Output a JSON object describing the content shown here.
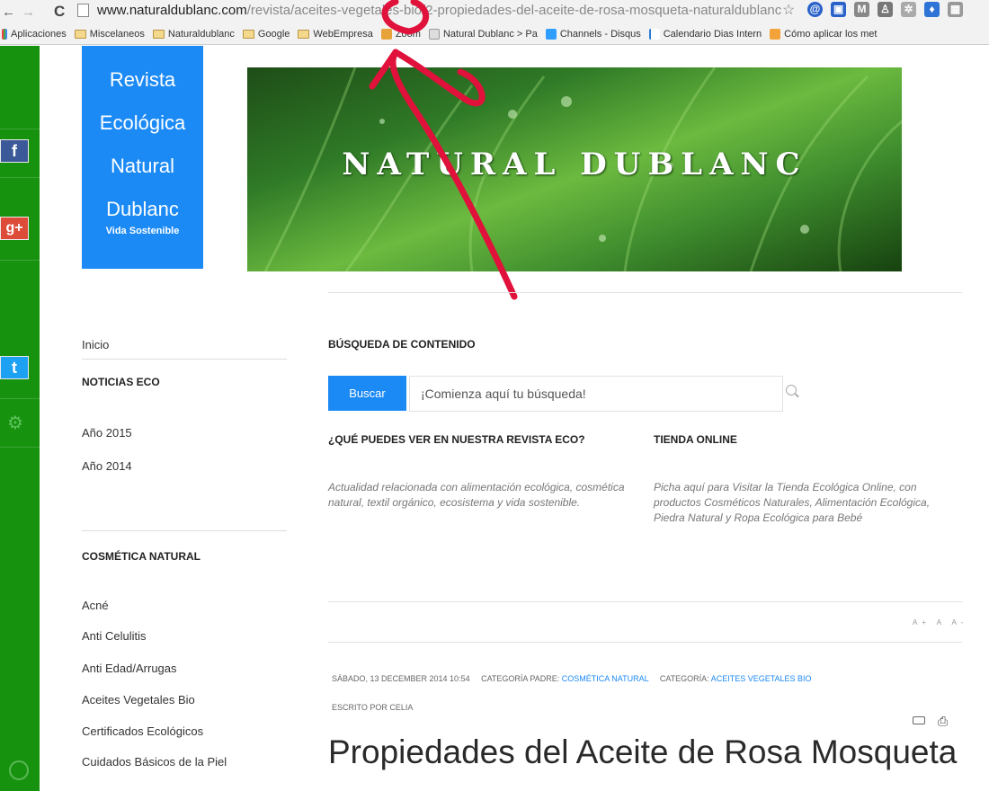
{
  "browser": {
    "url_host": "www.naturaldublanc.com",
    "url_path": "/revista/aceites-vegetales-bio/2-propiedades-del-aceite-de-rosa-mosqueta-naturaldublanc",
    "bookmarks": [
      "Aplicaciones",
      "Miscelaneos",
      "Naturaldublanc",
      "Google",
      "WebEmpresa",
      "Zoom",
      "Natural Dublanc > Pa",
      "Channels - Disqus",
      "Calendario Dias Intern",
      "Cómo aplicar los met"
    ]
  },
  "social": {
    "facebook": "f",
    "googleplus": "g+",
    "twitter": "t"
  },
  "logo": {
    "line1": "Revista",
    "line2": "Ecológica",
    "line3": "Natural",
    "line4": "Dublanc",
    "tagline": "Vida Sostenible"
  },
  "banner": {
    "title": "NATURAL DUBLANC"
  },
  "menu": {
    "home": "Inicio",
    "noticias_heading": "NOTICIAS ECO",
    "years": [
      "Año 2015",
      "Año 2014"
    ],
    "cosmetica_heading": "COSMÉTICA NATURAL",
    "cosmetica_items": [
      "Acné",
      "Anti Celulitis",
      "Anti Edad/Arrugas",
      "Aceites Vegetales Bio",
      "Certificados Ecológicos",
      "Cuidados Básicos de la Piel"
    ]
  },
  "search": {
    "title": "BÚSQUEDA DE CONTENIDO",
    "button": "Buscar",
    "placeholder": "¡Comienza aquí tu búsqueda!"
  },
  "columns": {
    "que_title": "¿QUÉ PUEDES VER EN NUESTRA REVISTA ECO?",
    "que_text": "Actualidad relacionada con alimentación ecológica, cosmética natural, textil orgánico, ecosistema y vida sostenible.",
    "tienda_title": "TIENDA ONLINE",
    "tienda_text": "Picha aquí para Visitar la Tienda Ecológica Online, con productos Cosméticos Naturales, Alimentación Ecológica, Piedra Natural y Ropa Ecológica para Bebé"
  },
  "font_tools": "A+ A A-",
  "article": {
    "date": "SÁBADO, 13 DECEMBER 2014 10:54",
    "parent_label": "CATEGORÍA PADRE:",
    "parent_value": "COSMÉTICA NATURAL",
    "category_label": "CATEGORÍA:",
    "category_value": "ACEITES VEGETALES BIO",
    "author": "ESCRITO POR CELIA",
    "title": "Propiedades del Aceite de Rosa Mosqueta"
  },
  "colors": {
    "green": "#17920f",
    "blue": "#1c8af5",
    "annotation_red": "#e0113a"
  }
}
